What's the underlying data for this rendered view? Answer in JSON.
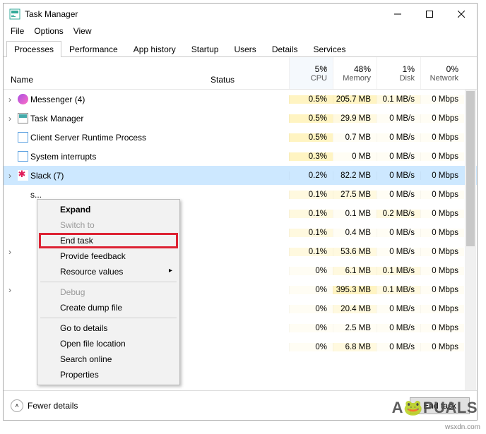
{
  "window": {
    "title": "Task Manager"
  },
  "menu": [
    "File",
    "Options",
    "View"
  ],
  "tabs": [
    "Processes",
    "Performance",
    "App history",
    "Startup",
    "Users",
    "Details",
    "Services"
  ],
  "active_tab": 0,
  "headers": {
    "name": "Name",
    "status": "Status",
    "cols": [
      {
        "pct": "5%",
        "label": "CPU"
      },
      {
        "pct": "48%",
        "label": "Memory"
      },
      {
        "pct": "1%",
        "label": "Disk"
      },
      {
        "pct": "0%",
        "label": "Network"
      }
    ]
  },
  "rows": [
    {
      "expand": true,
      "icon": "ico-msg",
      "name": "Messenger (4)",
      "cpu": "0.5%",
      "mem": "205.7 MB",
      "disk": "0.1 MB/s",
      "net": "0 Mbps",
      "heat_cpu": "heat1",
      "heat_mem": "heat1",
      "heat_disk": "heat2",
      "heat_net": "heat3"
    },
    {
      "expand": true,
      "icon": "ico-tm",
      "name": "Task Manager",
      "cpu": "0.5%",
      "mem": "29.9 MB",
      "disk": "0 MB/s",
      "net": "0 Mbps",
      "heat_cpu": "heat1",
      "heat_mem": "heat2",
      "heat_disk": "heat3",
      "heat_net": "heat3"
    },
    {
      "expand": false,
      "icon": "ico-cs",
      "name": "Client Server Runtime Process",
      "cpu": "0.5%",
      "mem": "0.7 MB",
      "disk": "0 MB/s",
      "net": "0 Mbps",
      "heat_cpu": "heat1",
      "heat_mem": "heat3",
      "heat_disk": "heat3",
      "heat_net": "heat3"
    },
    {
      "expand": false,
      "icon": "ico-sys",
      "name": "System interrupts",
      "cpu": "0.3%",
      "mem": "0 MB",
      "disk": "0 MB/s",
      "net": "0 Mbps",
      "heat_cpu": "heat1",
      "heat_mem": "heat3",
      "heat_disk": "heat3",
      "heat_net": "heat3"
    },
    {
      "expand": true,
      "icon": "ico-slack",
      "name": "Slack (7)",
      "cpu": "0.2%",
      "mem": "82.2 MB",
      "disk": "0 MB/s",
      "net": "0 Mbps",
      "selected": true,
      "heat_cpu": "",
      "heat_mem": "",
      "heat_disk": "",
      "heat_net": ""
    },
    {
      "expand": false,
      "icon": "",
      "name": "s...",
      "cpu": "0.1%",
      "mem": "27.5 MB",
      "disk": "0 MB/s",
      "net": "0 Mbps",
      "heat_cpu": "heat2",
      "heat_mem": "heat2",
      "heat_disk": "heat3",
      "heat_net": "heat3",
      "hidden_name": true
    },
    {
      "expand": false,
      "icon": "",
      "name": "",
      "cpu": "0.1%",
      "mem": "0.1 MB",
      "disk": "0.2 MB/s",
      "net": "0 Mbps",
      "heat_cpu": "heat2",
      "heat_mem": "heat3",
      "heat_disk": "heat2",
      "heat_net": "heat3",
      "hidden_name": true
    },
    {
      "expand": false,
      "icon": "",
      "name": "",
      "cpu": "0.1%",
      "mem": "0.4 MB",
      "disk": "0 MB/s",
      "net": "0 Mbps",
      "heat_cpu": "heat2",
      "heat_mem": "heat3",
      "heat_disk": "heat3",
      "heat_net": "heat3",
      "hidden_name": true
    },
    {
      "expand": true,
      "icon": "",
      "name": "",
      "cpu": "0.1%",
      "mem": "53.6 MB",
      "disk": "0 MB/s",
      "net": "0 Mbps",
      "heat_cpu": "heat2",
      "heat_mem": "heat2",
      "heat_disk": "heat3",
      "heat_net": "heat3",
      "hidden_name": true
    },
    {
      "expand": false,
      "icon": "",
      "name": "",
      "cpu": "0%",
      "mem": "6.1 MB",
      "disk": "0.1 MB/s",
      "net": "0 Mbps",
      "heat_cpu": "heat3",
      "heat_mem": "heat2",
      "heat_disk": "heat2",
      "heat_net": "heat3",
      "hidden_name": true,
      "trailing": true
    },
    {
      "expand": true,
      "icon": "",
      "name": "",
      "cpu": "0%",
      "mem": "395.3 MB",
      "disk": "0.1 MB/s",
      "net": "0 Mbps",
      "heat_cpu": "heat3",
      "heat_mem": "heat1",
      "heat_disk": "heat2",
      "heat_net": "heat3",
      "hidden_name": true
    },
    {
      "expand": false,
      "icon": "",
      "name": "",
      "cpu": "0%",
      "mem": "20.4 MB",
      "disk": "0 MB/s",
      "net": "0 Mbps",
      "heat_cpu": "heat3",
      "heat_mem": "heat2",
      "heat_disk": "heat3",
      "heat_net": "heat3",
      "hidden_name": true
    },
    {
      "expand": false,
      "icon": "",
      "name": "",
      "cpu": "0%",
      "mem": "2.5 MB",
      "disk": "0 MB/s",
      "net": "0 Mbps",
      "heat_cpu": "heat3",
      "heat_mem": "heat3",
      "heat_disk": "heat3",
      "heat_net": "heat3",
      "hidden_name": true
    },
    {
      "expand": false,
      "icon": "",
      "name": "",
      "cpu": "0%",
      "mem": "6.8 MB",
      "disk": "0 MB/s",
      "net": "0 Mbps",
      "heat_cpu": "heat3",
      "heat_mem": "heat2",
      "heat_disk": "heat3",
      "heat_net": "heat3",
      "hidden_name": true
    }
  ],
  "context_menu": [
    {
      "label": "Expand",
      "bold": true
    },
    {
      "label": "Switch to",
      "disabled": true
    },
    {
      "label": "End task",
      "highlight": true
    },
    {
      "label": "Provide feedback"
    },
    {
      "label": "Resource values",
      "submenu": true
    },
    {
      "sep": true
    },
    {
      "label": "Debug",
      "disabled": true
    },
    {
      "label": "Create dump file"
    },
    {
      "sep": true
    },
    {
      "label": "Go to details"
    },
    {
      "label": "Open file location"
    },
    {
      "label": "Search online"
    },
    {
      "label": "Properties"
    }
  ],
  "footer": {
    "fewer": "Fewer details",
    "end_task": "End task"
  },
  "watermark": {
    "brand_a": "A",
    "brand_mid": "🐸",
    "brand_b": "PUALS",
    "site": "wsxdn.com"
  }
}
